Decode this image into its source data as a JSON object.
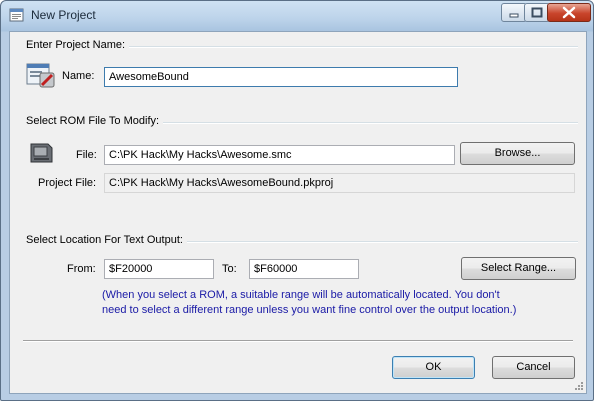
{
  "window": {
    "title": "New Project"
  },
  "section_project": {
    "header": "Enter Project Name:",
    "name_label": "Name:",
    "name_value": "AwesomeBound"
  },
  "section_rom": {
    "header": "Select ROM File To Modify:",
    "file_label": "File:",
    "file_value": "C:\\PK Hack\\My Hacks\\Awesome.smc",
    "browse_button": "Browse...",
    "project_file_label": "Project File:",
    "project_file_value": "C:\\PK Hack\\My Hacks\\AwesomeBound.pkproj"
  },
  "section_location": {
    "header": "Select Location For Text Output:",
    "from_label": "From:",
    "from_value": "$F20000",
    "to_label": "To:",
    "to_value": "$F60000",
    "select_range_button": "Select Range...",
    "note_line1": "(When you select a ROM, a suitable range will be automatically located. You don't",
    "note_line2": "need to select a different range unless you want fine control over the output location.)"
  },
  "footer": {
    "ok_button": "OK",
    "cancel_button": "Cancel"
  },
  "colors": {
    "titlebar": "#bcd3ea",
    "close": "#c9452c",
    "note": "#1a1aa6",
    "dialog": "#f0f0f0"
  }
}
